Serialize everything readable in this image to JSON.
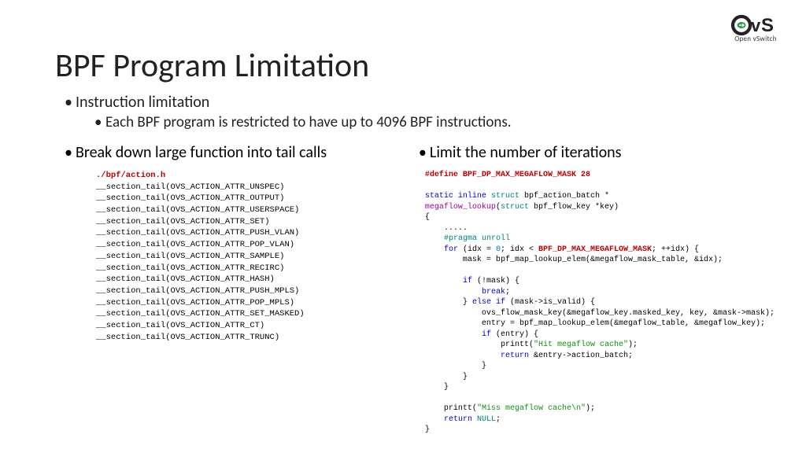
{
  "logo": {
    "brand": "OvS",
    "subtext": "Open vSwitch"
  },
  "title": "BPF Program Limitation",
  "bullets": {
    "b1": "Instruction limitation",
    "b1a": "Each BPF program is restricted to have up to 4096 BPF instructions.",
    "left_head": "Break down large function into tail calls",
    "right_head": "Limit the number of iterations"
  },
  "code_left": {
    "header": "./bpf/action.h",
    "lines": [
      "__section_tail(OVS_ACTION_ATTR_UNSPEC)",
      "__section_tail(OVS_ACTION_ATTR_OUTPUT)",
      "__section_tail(OVS_ACTION_ATTR_USERSPACE)",
      "__section_tail(OVS_ACTION_ATTR_SET)",
      "__section_tail(OVS_ACTION_ATTR_PUSH_VLAN)",
      "__section_tail(OVS_ACTION_ATTR_POP_VLAN)",
      "__section_tail(OVS_ACTION_ATTR_SAMPLE)",
      "__section_tail(OVS_ACTION_ATTR_RECIRC)",
      "__section_tail(OVS_ACTION_ATTR_HASH)",
      "__section_tail(OVS_ACTION_ATTR_PUSH_MPLS)",
      "__section_tail(OVS_ACTION_ATTR_POP_MPLS)",
      "__section_tail(OVS_ACTION_ATTR_SET_MASKED)",
      "__section_tail(OVS_ACTION_ATTR_CT)",
      "__section_tail(OVS_ACTION_ATTR_TRUNC)"
    ]
  },
  "code_right": {
    "define": "#define BPF_DP_MAX_MEGAFLOW_MASK 28",
    "sig1": "static inline struct bpf_action_batch *",
    "sig2": "megaflow_lookup(struct bpf_flow_key *key)",
    "open": "{",
    "ellipsis": "    .....",
    "pragma": "    #pragma unroll",
    "for_pre": "    for (idx = 0; idx < ",
    "for_const": "BPF_DP_MAX_MEGAFLOW_MASK",
    "for_post": "; ++idx) {",
    "l_mask": "        mask = bpf_map_lookup_elem(&megaflow_mask_table, &idx);",
    "l_if1": "        if (!mask) {",
    "l_break": "            break;",
    "l_elseif": "        } else if (mask->is_valid) {",
    "l_ovsflow": "            ovs_flow_mask_key(&megaflow_key.masked_key, key, &mask->mask);",
    "l_entry": "            entry = bpf_map_lookup_elem(&megaflow_table, &megaflow_key);",
    "l_ifentry": "            if (entry) {",
    "l_printhit_pre": "                printt(",
    "l_printhit_str": "\"Hit megaflow cache\"",
    "l_printhit_post": ");",
    "l_return1_pre": "                return ",
    "l_return1_post": "&entry->action_batch;",
    "l_close1": "            }",
    "l_close2": "        }",
    "l_close3": "    }",
    "l_printmiss_pre": "    printt(",
    "l_printmiss_str": "\"Miss megaflow cache\\n\"",
    "l_printmiss_post": ");",
    "l_returnnull_pre": "    return ",
    "l_null": "NULL",
    "l_returnnull_post": ";",
    "close": "}"
  }
}
